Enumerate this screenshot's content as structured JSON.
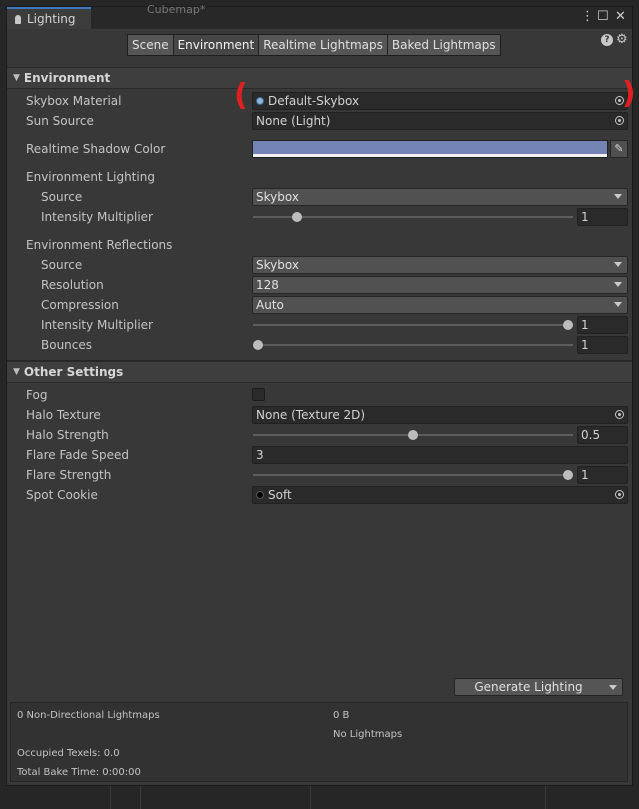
{
  "window": {
    "title": "Lighting",
    "ghost_tab": "Cubemap*",
    "menu_icon": "kebab-menu-icon",
    "maximize_icon": "maximize-icon",
    "close_icon": "close-icon"
  },
  "toolbar": {
    "tabs": [
      {
        "label": "Scene",
        "active": false
      },
      {
        "label": "Environment",
        "active": true
      },
      {
        "label": "Realtime Lightmaps",
        "active": false
      },
      {
        "label": "Baked Lightmaps",
        "active": false
      }
    ],
    "help_icon": "help-icon",
    "settings_icon": "gear-icon",
    "help_glyph": "?"
  },
  "environment": {
    "header": "Environment",
    "skybox_material": {
      "label": "Skybox Material",
      "value": "Default-Skybox"
    },
    "sun_source": {
      "label": "Sun Source",
      "value": "None (Light)"
    },
    "realtime_shadow_color": {
      "label": "Realtime Shadow Color",
      "color": "#7383b3"
    },
    "lighting": {
      "label": "Environment Lighting",
      "source": {
        "label": "Source",
        "value": "Skybox"
      },
      "intensity": {
        "label": "Intensity Multiplier",
        "value": "1",
        "fraction": 0.125
      }
    },
    "reflections": {
      "label": "Environment Reflections",
      "source": {
        "label": "Source",
        "value": "Skybox"
      },
      "resolution": {
        "label": "Resolution",
        "value": "128"
      },
      "compression": {
        "label": "Compression",
        "value": "Auto"
      },
      "intensity": {
        "label": "Intensity Multiplier",
        "value": "1",
        "fraction": 1.0
      },
      "bounces": {
        "label": "Bounces",
        "value": "1",
        "fraction": 0.0
      }
    }
  },
  "other": {
    "header": "Other Settings",
    "fog": {
      "label": "Fog",
      "checked": false
    },
    "halo_texture": {
      "label": "Halo Texture",
      "value": "None (Texture 2D)"
    },
    "halo_strength": {
      "label": "Halo Strength",
      "value": "0.5",
      "fraction": 0.5
    },
    "flare_fade_speed": {
      "label": "Flare Fade Speed",
      "value": "3"
    },
    "flare_strength": {
      "label": "Flare Strength",
      "value": "1",
      "fraction": 1.0
    },
    "spot_cookie": {
      "label": "Spot Cookie",
      "value": "Soft"
    }
  },
  "generate": {
    "label": "Generate Lighting"
  },
  "stats": {
    "non_directional": "0 Non-Directional Lightmaps",
    "size": "0 B",
    "no_lightmaps": "No Lightmaps",
    "occupied_texels": "Occupied Texels: 0.0",
    "bake_time": "Total Bake Time: 0:00:00"
  },
  "annotation": {
    "left_mark": "(",
    "right_mark": ")",
    "color": "#e02020"
  }
}
